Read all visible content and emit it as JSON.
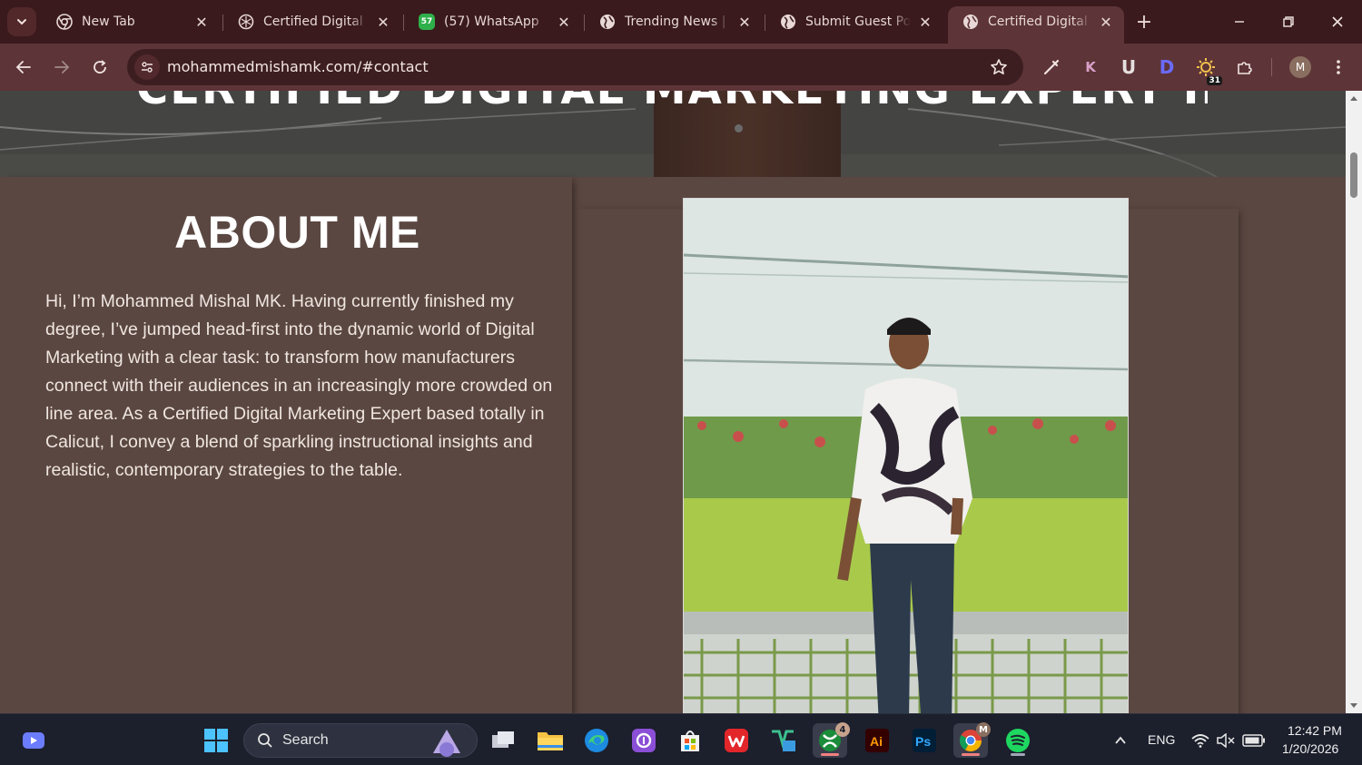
{
  "browser": {
    "tabs": [
      {
        "title": "New Tab",
        "favicon": "chrome-icon",
        "active": false
      },
      {
        "title": "Certified Digital Marketing Expert",
        "favicon": "chatgpt-icon",
        "active": false
      },
      {
        "title": "(57) WhatsApp",
        "favicon": "whatsapp-icon",
        "badge": "57",
        "active": false
      },
      {
        "title": "Trending News | India",
        "favicon": "globe-icon",
        "active": false
      },
      {
        "title": "Submit Guest Post",
        "favicon": "globe-icon",
        "active": false
      },
      {
        "title": "Certified Digital Marketing Expert",
        "favicon": "globe-icon",
        "active": true
      }
    ],
    "address": "mohammedmishamk.com/#contact",
    "extensions": {
      "k_label": "K",
      "u_label": "U",
      "d_label": "D",
      "sun_badge": "31"
    },
    "profile_initial": "M",
    "colors": {
      "frame": "#3a1a1c",
      "toolbar": "#5d3437"
    }
  },
  "page": {
    "hero_heading": "CERTIFIED DIGITAL MARKETING EXPERT IN CALICUT",
    "about": {
      "title": "ABOUT ME",
      "body": "Hi, I’m Mohammed Mishal MK. Having currently finished my degree, I’ve jumped head-first into the dynamic world of Digital Marketing with a clear task: to transform how manufacturers connect with their audiences in an increasingly more crowded on line area. As a Certified Digital Marketing Expert based totally in Calicut, I convey a blend of sparkling instructional insights and realistic, contemporary strategies to the table."
    },
    "colors": {
      "background": "#5b4741",
      "text": "#efe6e2"
    }
  },
  "taskbar": {
    "search_placeholder": "Search",
    "xbox_badge": "4",
    "chrome_badge": "M",
    "language": "ENG",
    "time": "12:42 PM",
    "date": "1/20/2026"
  }
}
